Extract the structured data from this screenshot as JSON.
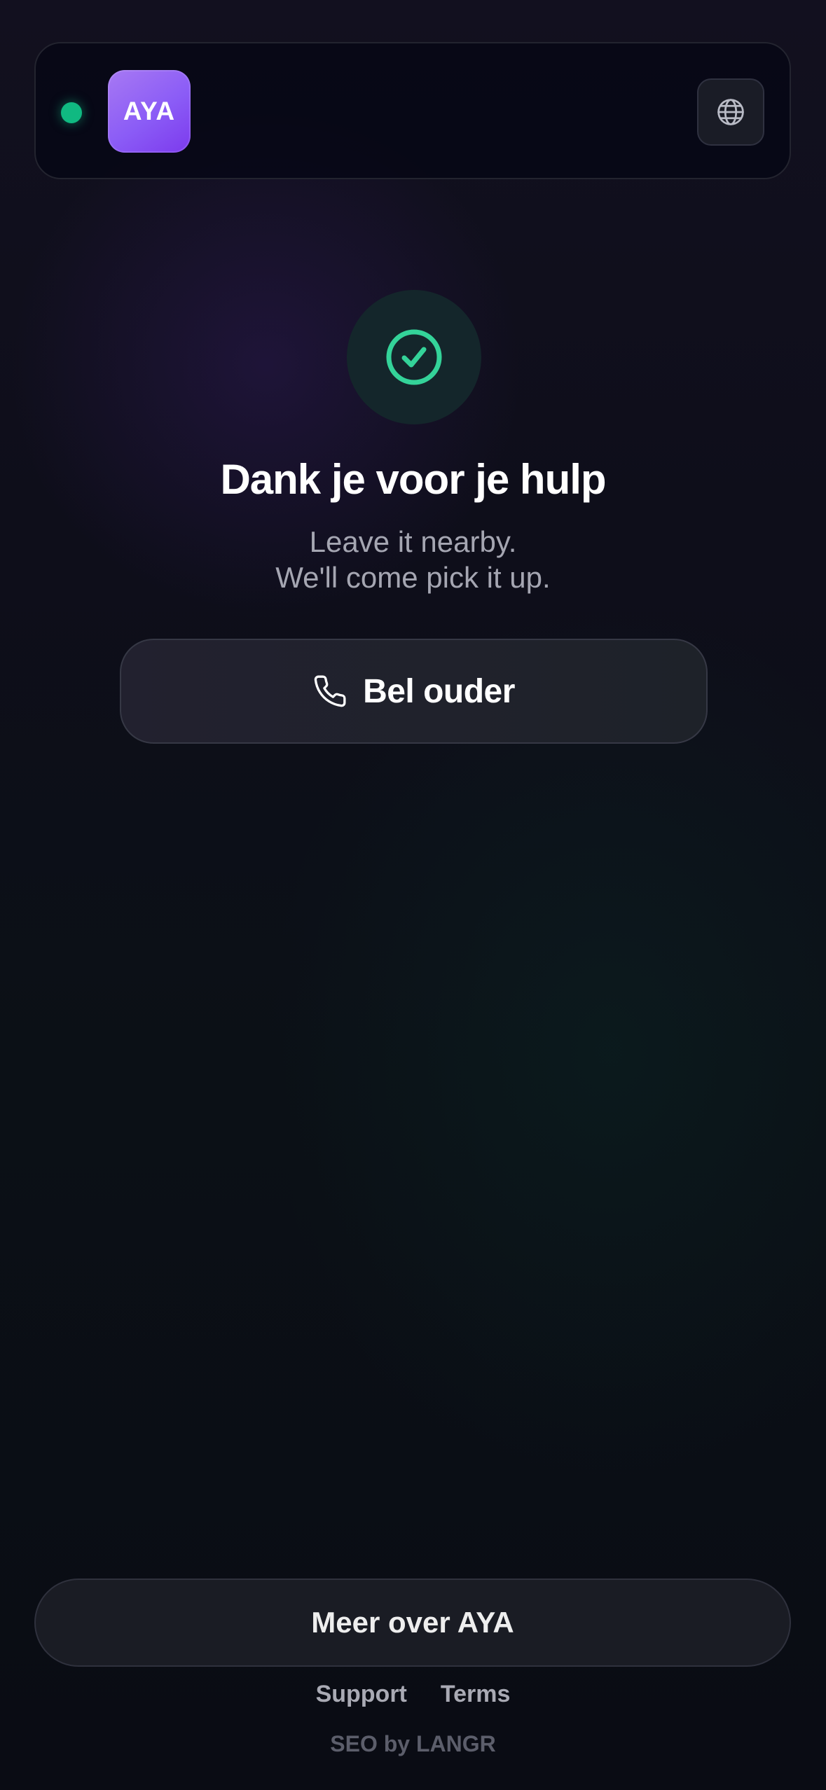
{
  "header": {
    "logo_text": "AYA",
    "status_color": "#10b981",
    "logo_color": "#8b5cf6",
    "language_icon": "globe-icon"
  },
  "main": {
    "status_icon": "check-circle-icon",
    "accent_color": "#34d399",
    "title": "Dank je voor je hulp",
    "subtitle_line1": "Leave it nearby.",
    "subtitle_line2": "We'll come pick it up.",
    "call_button": {
      "icon": "phone-icon",
      "label": "Bel ouder"
    }
  },
  "footer": {
    "more_button_label": "Meer over AYA",
    "links": [
      "Support",
      "Terms"
    ],
    "credit": "SEO by LANGR"
  }
}
